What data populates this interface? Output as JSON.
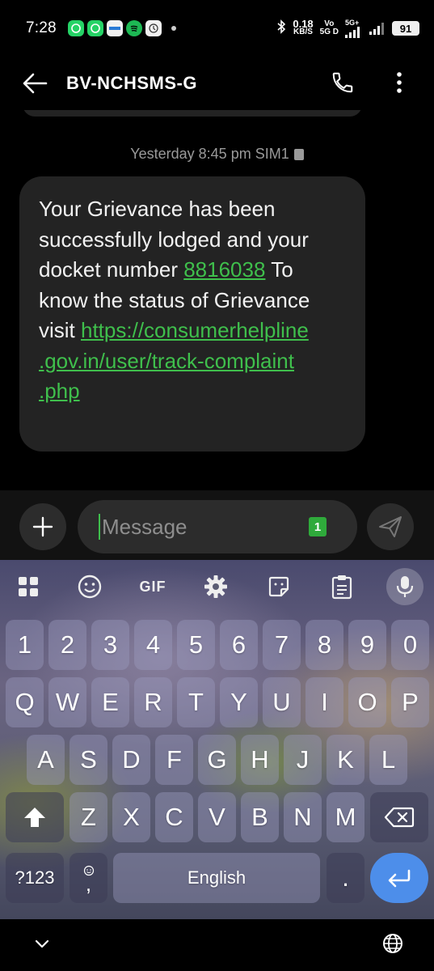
{
  "status_bar": {
    "time": "7:28",
    "net_speed_value": "0.18",
    "net_speed_unit": "KB/S",
    "volte": "Vo",
    "volte_sub": "5G D",
    "network": "5G+",
    "battery": "91"
  },
  "header": {
    "contact_name": "BV-NCHSMS-G"
  },
  "conversation": {
    "timestamp": "Yesterday 8:45 pm SIM1",
    "message_part1": "Your Grievance has been successfully lodged and your docket number ",
    "docket_number": "8816038",
    "message_part2": " To know the status of Grievance visit ",
    "link": "https://consumerhelpline.gov.in/user/track-complaint.php",
    "link_line1": "https://consumerhelpline",
    "link_line2": ".gov.in/user/track-complaint",
    "link_line3": ".php"
  },
  "compose": {
    "placeholder": "Message",
    "sim_badge": "1"
  },
  "keyboard": {
    "toolbar": {
      "gif_label": "GIF"
    },
    "number_row": [
      "1",
      "2",
      "3",
      "4",
      "5",
      "6",
      "7",
      "8",
      "9",
      "0"
    ],
    "row1": [
      "Q",
      "W",
      "E",
      "R",
      "T",
      "Y",
      "U",
      "I",
      "O",
      "P"
    ],
    "row2": [
      "A",
      "S",
      "D",
      "F",
      "G",
      "H",
      "J",
      "K",
      "L"
    ],
    "row3": [
      "Z",
      "X",
      "C",
      "V",
      "B",
      "N",
      "M"
    ],
    "symbols_key": "?123",
    "emoji_key_label": ",",
    "space_label": "English",
    "period_key": "."
  },
  "colors": {
    "link": "#3fbf4c",
    "bubble": "#232323",
    "enter_key": "#4d8eea"
  }
}
